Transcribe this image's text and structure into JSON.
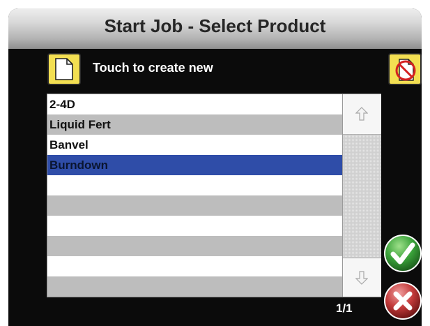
{
  "header": {
    "title": "Start Job - Select Product"
  },
  "actions": {
    "create_new_label": "Touch to create new"
  },
  "product_list": {
    "items": [
      {
        "label": "2-4D",
        "selected": false
      },
      {
        "label": "Liquid Fert",
        "selected": false
      },
      {
        "label": "Banvel",
        "selected": false
      },
      {
        "label": "Burndown",
        "selected": true
      },
      {
        "label": "",
        "selected": false
      },
      {
        "label": "",
        "selected": false
      },
      {
        "label": "",
        "selected": false
      },
      {
        "label": "",
        "selected": false
      },
      {
        "label": "",
        "selected": false
      },
      {
        "label": "",
        "selected": false
      }
    ],
    "selected_color": "#2f4da8"
  },
  "pagination": {
    "indicator": "1/1"
  },
  "icons": {
    "new": "new-document-icon",
    "cancel_new": "no-document-icon",
    "scroll_up": "arrow-up-icon",
    "scroll_down": "arrow-down-icon",
    "accept": "checkmark-icon",
    "cancel": "x-icon"
  },
  "colors": {
    "accept": "#3aa23a",
    "cancel": "#c23a3a",
    "button_yellow": "#f3df52"
  }
}
